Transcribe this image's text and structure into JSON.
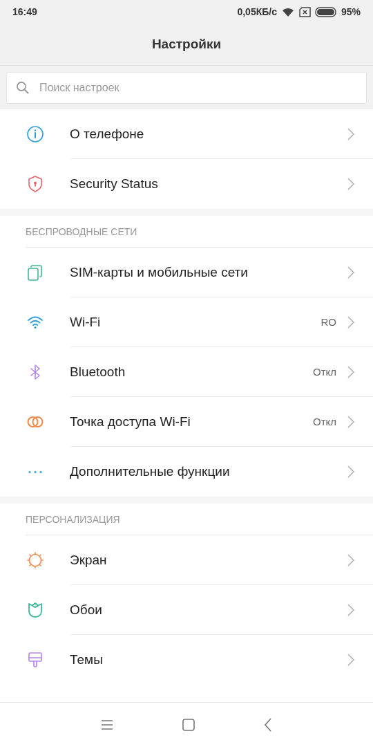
{
  "status_bar": {
    "time": "16:49",
    "speed": "0,05КБ/с",
    "battery_percent": "95%"
  },
  "title": "Настройки",
  "search": {
    "placeholder": "Поиск настроек"
  },
  "sections": [
    {
      "items": [
        {
          "kind": "info",
          "label": "О телефоне"
        },
        {
          "kind": "shield",
          "label": "Security Status"
        }
      ]
    },
    {
      "header": "БЕСПРОВОДНЫЕ СЕТИ",
      "items": [
        {
          "kind": "sim",
          "label": "SIM-карты и мобильные сети"
        },
        {
          "kind": "wifi",
          "label": "Wi-Fi",
          "value": "RO"
        },
        {
          "kind": "bluetooth",
          "label": "Bluetooth",
          "value": "Откл"
        },
        {
          "kind": "hotspot",
          "label": "Точка доступа Wi-Fi",
          "value": "Откл"
        },
        {
          "kind": "more",
          "label": "Дополнительные функции"
        }
      ]
    },
    {
      "header": "ПЕРСОНАЛИЗАЦИЯ",
      "items": [
        {
          "kind": "display",
          "label": "Экран"
        },
        {
          "kind": "wallpaper",
          "label": "Обои"
        },
        {
          "kind": "themes",
          "label": "Темы"
        }
      ]
    }
  ]
}
